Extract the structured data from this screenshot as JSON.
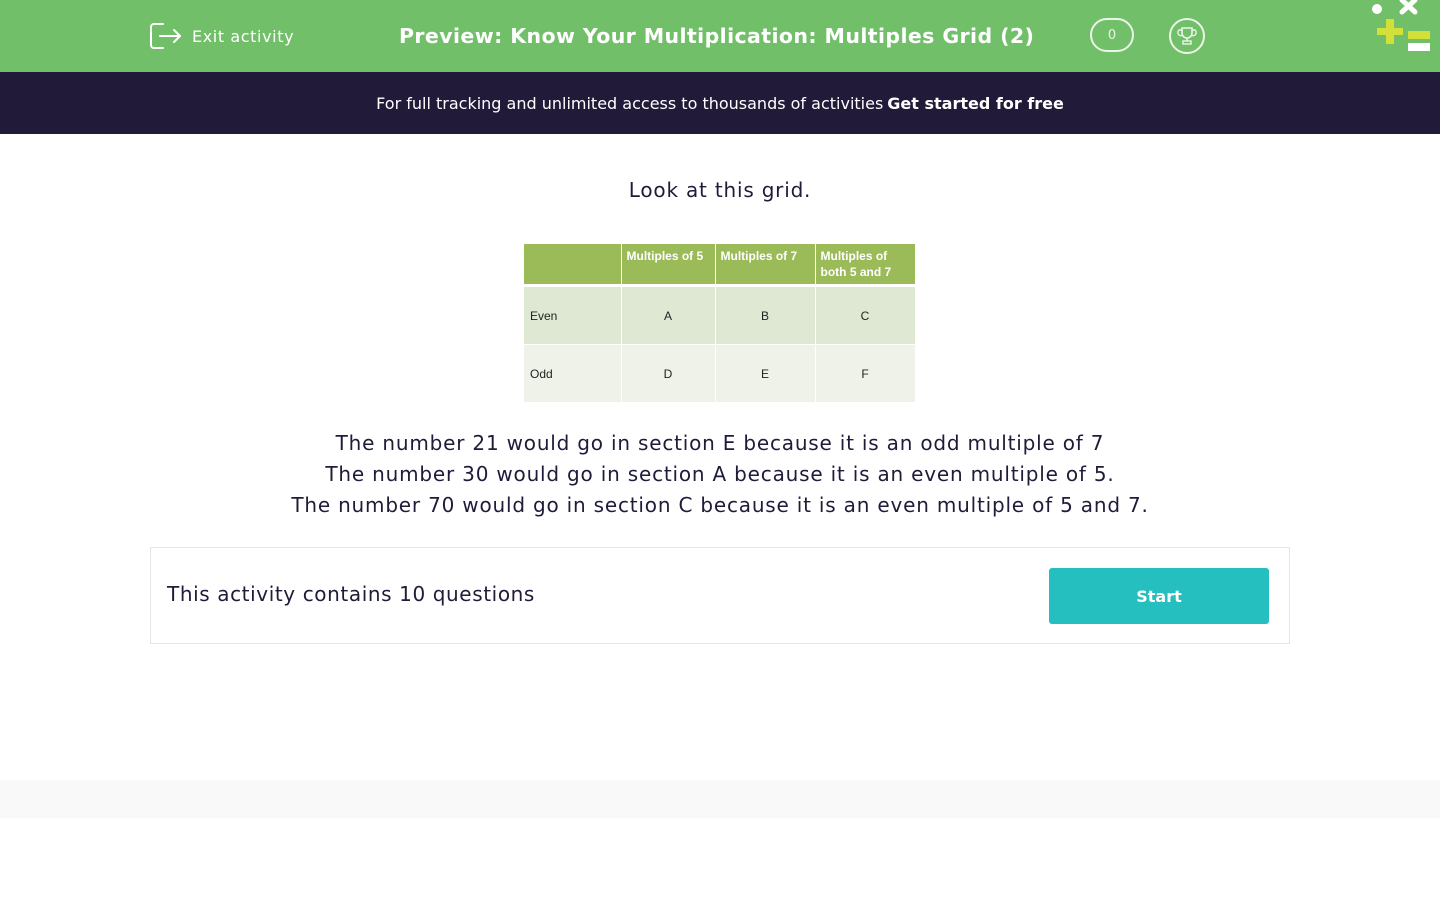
{
  "header": {
    "exit_label": "Exit activity",
    "title": "Preview: Know Your Multiplication: Multiples Grid (2)",
    "score": "0",
    "exit_icon": "exit-icon",
    "trophy_icon": "trophy-icon",
    "background_color": "#72bf6a"
  },
  "promo": {
    "text": "For full tracking and unlimited access to thousands of activities",
    "link": "Get started for free",
    "background_color": "#221a39"
  },
  "main": {
    "intro": "Look at this grid.",
    "grid": {
      "headers": [
        "",
        "Multiples of 5",
        "Multiples of 7",
        "Multiples of both 5 and 7"
      ],
      "rows": [
        [
          "Even",
          "A",
          "B",
          "C"
        ],
        [
          "Odd",
          "D",
          "E",
          "F"
        ]
      ],
      "header_color": "#9bbb59"
    },
    "explanations": [
      "The number 21 would go in section E because it is an odd multiple of 7",
      "The number 30 would go in section A because it is an even multiple of 5.",
      "The number 70 would go in section C because it is an even multiple of 5 and 7."
    ]
  },
  "activity": {
    "question_count_text": "This activity contains 10 questions",
    "start_label": "Start",
    "button_color": "#26bfbf"
  }
}
